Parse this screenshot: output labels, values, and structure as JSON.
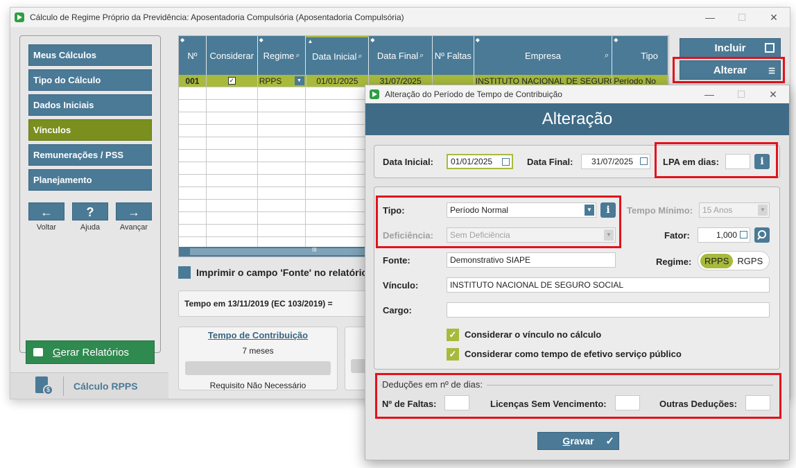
{
  "window": {
    "title": "Cálculo de Regime Próprio da Previdência: Aposentadoria Compulsória (Aposentadoria Compulsória)",
    "controls": [
      "—",
      "☐",
      "✕"
    ]
  },
  "sidebar": {
    "items": [
      {
        "label": "Meus Cálculos",
        "active": false
      },
      {
        "label": "Tipo do Cálculo",
        "active": false
      },
      {
        "label": "Dados Iniciais",
        "active": false
      },
      {
        "label": "Vínculos",
        "active": true
      },
      {
        "label": "Remunerações / PSS",
        "active": false
      },
      {
        "label": "Planejamento",
        "active": false
      }
    ],
    "nav": [
      {
        "symbol": "←",
        "label": "Voltar"
      },
      {
        "symbol": "?",
        "label": "Ajuda"
      },
      {
        "symbol": "→",
        "label": "Avançar"
      }
    ],
    "report_button": "Gerar Relatórios",
    "report_button_first": "G",
    "report_button_rest": "erar Relatórios",
    "footer_label": "Cálculo RPPS",
    "coin_symbol": "$"
  },
  "grid": {
    "columns": [
      "Nº",
      "Considerar",
      "Regime",
      "Data Inicial",
      "Data Final",
      "Nº Faltas",
      "Empresa",
      "Tipo"
    ],
    "rows": [
      {
        "num": "001",
        "considerar": "✓",
        "regime": "RPPS",
        "data_inicial": "01/01/2025",
        "data_final": "31/07/2025",
        "faltas": "",
        "empresa": "INSTITUTO NACIONAL DE SEGURO",
        "tipo": "Período No"
      }
    ],
    "scroll_marker": "III"
  },
  "main": {
    "print_checkbox_label": "Imprimir o campo 'Fonte' no relatório d",
    "tempo_label": "Tempo em 13/11/2019 (EC 103/2019) =",
    "contrib_title": "Tempo de Contribuição",
    "contrib_value": "7 meses",
    "contrib_footer": "Requisito Não Necessário"
  },
  "actions": {
    "incluir": "Incluir",
    "alterar": "Alterar"
  },
  "dialog": {
    "title": "Alteração do Período de Tempo de Contribuição",
    "header": "Alteração",
    "data_inicial_label": "Data Inicial:",
    "data_inicial": "01/01/2025",
    "data_final_label": "Data Final:",
    "data_final": "31/07/2025",
    "lpa_label": "LPA em dias:",
    "lpa_value": "",
    "tipo_label": "Tipo:",
    "tipo_value": "Período Normal",
    "tempo_minimo_label": "Tempo Mínimo:",
    "tempo_minimo_value": "15 Anos",
    "deficiencia_label": "Deficiência:",
    "deficiencia_value": "Sem Deficiência",
    "fator_label": "Fator:",
    "fator_value": "1,000",
    "fonte_label": "Fonte:",
    "fonte_value": "Demonstrativo SIAPE",
    "regime_label": "Regime:",
    "regime_options": [
      "RPPS",
      "RGPS"
    ],
    "regime_selected": "RPPS",
    "vinculo_label": "Vínculo:",
    "vinculo_value": "INSTITUTO NACIONAL DE SEGURO SOCIAL",
    "cargo_label": "Cargo:",
    "cargo_value": "",
    "check1_label": "Considerar o vínculo no cálculo",
    "check2_label": "Considerar como tempo de efetivo serviço público",
    "deducoes_legend": "Deduções em nº de dias:",
    "faltas_label": "Nº de Faltas:",
    "licencas_label": "Licenças Sem Vencimento:",
    "outras_label": "Outras Deduções:",
    "gravar_first": "G",
    "gravar_rest": "ravar",
    "info_symbol": "i",
    "check_symbol": "✓"
  },
  "colors": {
    "primary": "#4a7a96",
    "active": "#7a8f1e",
    "highlight_row": "#a8ba3c",
    "report": "#2f8a4f",
    "annotation": "#e2121b"
  }
}
